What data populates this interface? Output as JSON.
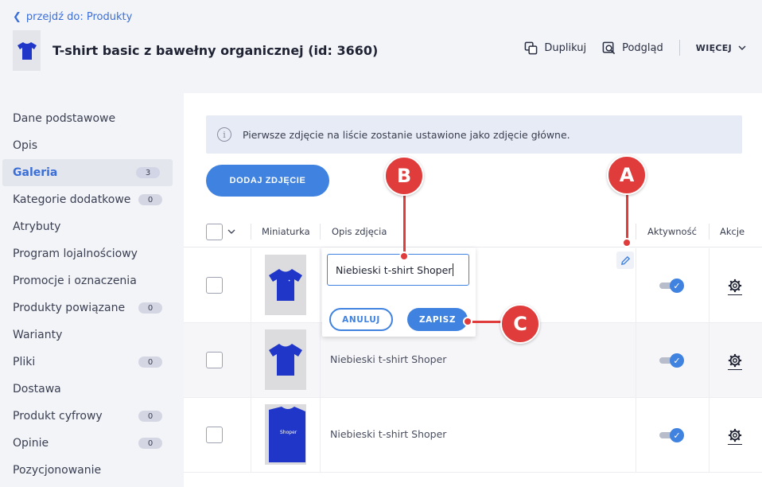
{
  "header": {
    "back_link": "przejdź do: Produkty",
    "product_title": "T-shirt basic z bawełny organicznej (id: 3660)",
    "actions": {
      "duplicate": "Duplikuj",
      "preview": "Podgląd",
      "more": "WIĘCEJ"
    }
  },
  "sidebar": {
    "items": [
      {
        "label": "Dane podstawowe",
        "badge": ""
      },
      {
        "label": "Opis",
        "badge": ""
      },
      {
        "label": "Galeria",
        "badge": "3"
      },
      {
        "label": "Kategorie dodatkowe",
        "badge": "0"
      },
      {
        "label": "Atrybuty",
        "badge": ""
      },
      {
        "label": "Program lojalnościowy",
        "badge": ""
      },
      {
        "label": "Promocje i oznaczenia",
        "badge": ""
      },
      {
        "label": "Produkty powiązane",
        "badge": "0"
      },
      {
        "label": "Warianty",
        "badge": ""
      },
      {
        "label": "Pliki",
        "badge": "0"
      },
      {
        "label": "Dostawa",
        "badge": ""
      },
      {
        "label": "Produkt cyfrowy",
        "badge": "0"
      },
      {
        "label": "Opinie",
        "badge": "0"
      },
      {
        "label": "Pozycjonowanie",
        "badge": ""
      }
    ],
    "active": "Galeria"
  },
  "gallery": {
    "info_text": "Pierwsze zdjęcie na liście zostanie ustawione jako zdjęcie główne.",
    "add_button": "DODAJ ZDJĘCIE",
    "columns": {
      "thumbnail": "Miniaturka",
      "description": "Opis zdjęcia",
      "active": "Aktywność",
      "actions": "Akcje"
    },
    "rows": [
      {
        "description": "Niebieski t-shirt Shoper",
        "active": true
      },
      {
        "description": "Niebieski t-shirt Shoper",
        "active": true
      },
      {
        "description": "Niebieski t-shirt Shoper",
        "active": true
      }
    ],
    "edit": {
      "value": "Niebieski t-shirt Shoper",
      "cancel": "ANULUJ",
      "save": "ZAPISZ"
    }
  },
  "callouts": {
    "a": "A",
    "b": "B",
    "c": "C"
  },
  "colors": {
    "accent": "#3f82e0",
    "callout": "#e03c3c",
    "tshirt": "#1f36c9"
  }
}
